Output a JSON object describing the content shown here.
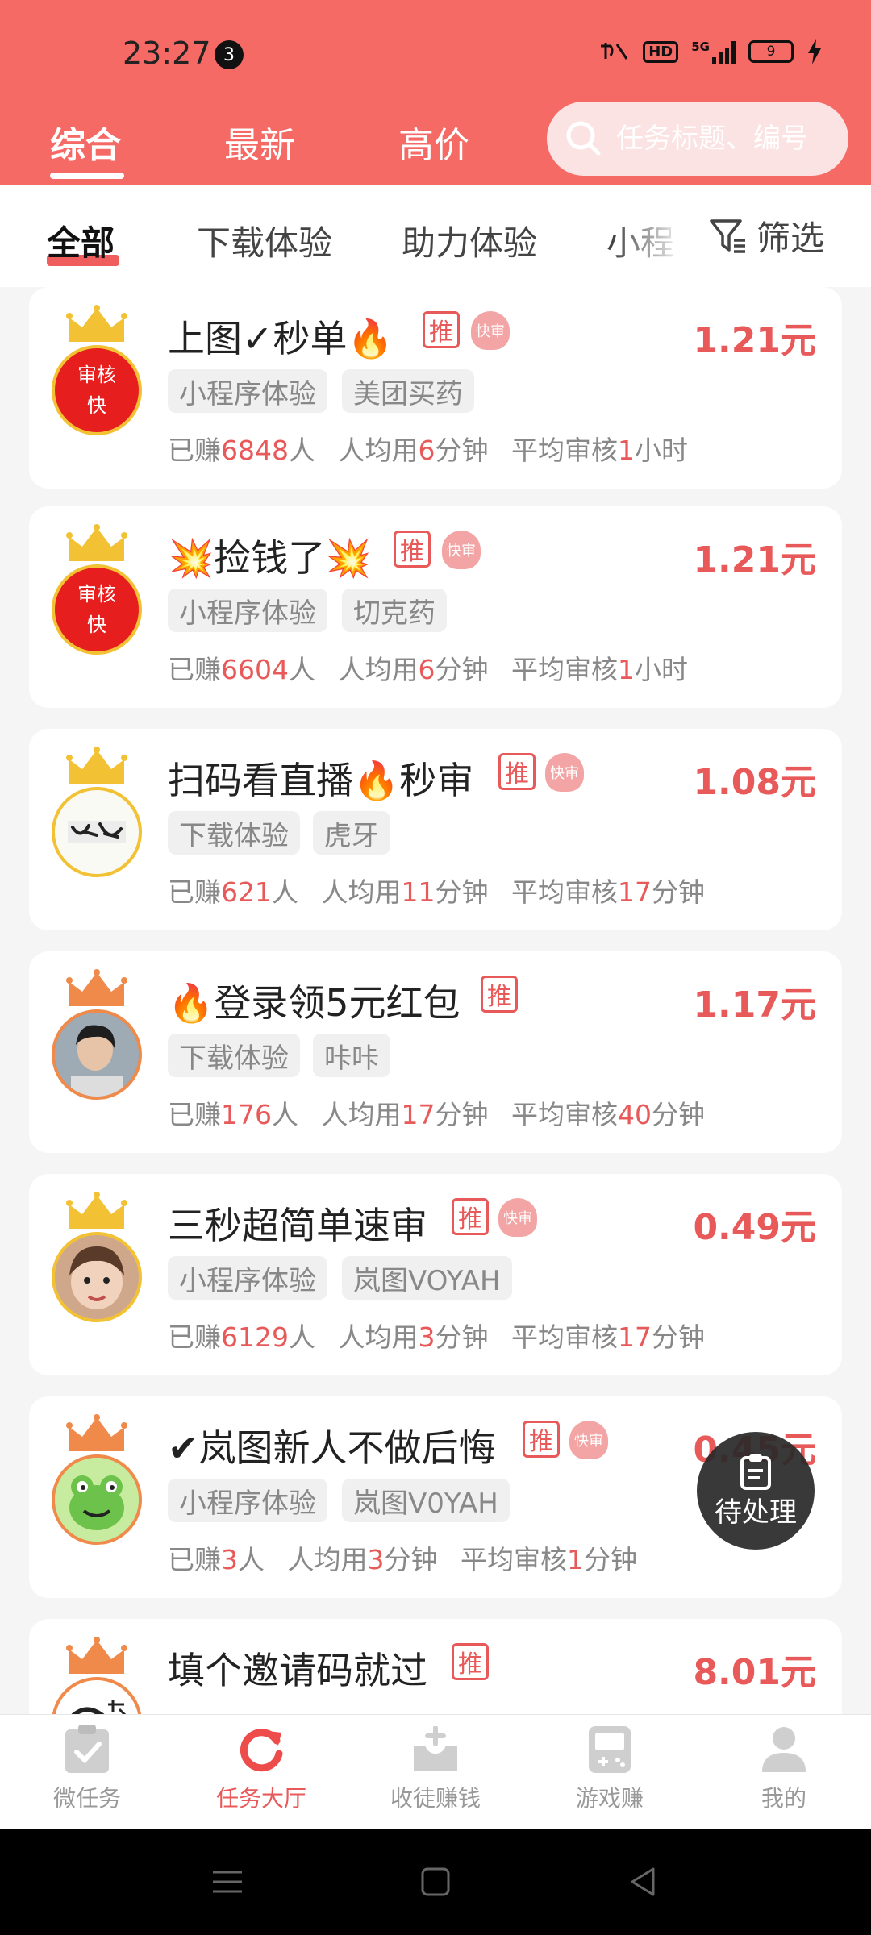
{
  "status": {
    "time": "23:27",
    "notif_count": "3",
    "hd": "HD",
    "network": "5G",
    "battery": "9"
  },
  "top_tabs": [
    {
      "label": "综合",
      "active": true
    },
    {
      "label": "最新",
      "active": false
    },
    {
      "label": "高价",
      "active": false
    }
  ],
  "search": {
    "placeholder": "任务标题、编号"
  },
  "categories": [
    {
      "label": "全部",
      "active": true
    },
    {
      "label": "下载体验"
    },
    {
      "label": "助力体验"
    },
    {
      "label": "小程"
    }
  ],
  "filter_label": "筛选",
  "tags": {
    "recommend": "推",
    "fast": "快审"
  },
  "avatar_text": {
    "review_fast_top": "审核",
    "review_fast_bottom": "快"
  },
  "tasks": [
    {
      "title": "上图✓秒单🔥",
      "price": "1.21元",
      "fast": true,
      "chips": [
        "小程序体验",
        "美团买药"
      ],
      "earned": "6848",
      "minutes": "6",
      "review_num": "1",
      "review_unit": "小时",
      "avatar": "review-fast",
      "crown": "gold"
    },
    {
      "title": "💥捡钱了💥",
      "price": "1.21元",
      "fast": true,
      "chips": [
        "小程序体验",
        "切克药"
      ],
      "earned": "6604",
      "minutes": "6",
      "review_num": "1",
      "review_unit": "小时",
      "avatar": "review-fast",
      "crown": "gold"
    },
    {
      "title": "扫码看直播🔥秒审",
      "price": "1.08元",
      "fast": true,
      "chips": [
        "下载体验",
        "虎牙"
      ],
      "earned": "621",
      "minutes": "11",
      "review_num": "17",
      "review_unit": "分钟",
      "avatar": "calligraphy",
      "crown": "gold"
    },
    {
      "title": "🔥登录领5元红包",
      "price": "1.17元",
      "fast": false,
      "chips": [
        "下载体验",
        "咔咔"
      ],
      "earned": "176",
      "minutes": "17",
      "review_num": "40",
      "review_unit": "分钟",
      "avatar": "person",
      "crown": "orange"
    },
    {
      "title": "三秒超简单速审",
      "price": "0.49元",
      "fast": true,
      "chips": [
        "小程序体验",
        "岚图VOYAH"
      ],
      "earned": "6129",
      "minutes": "3",
      "review_num": "17",
      "review_unit": "分钟",
      "avatar": "child",
      "crown": "gold"
    },
    {
      "title": "✔岚图新人不做后悔",
      "price": "0.45元",
      "fast": true,
      "chips": [
        "小程序体验",
        "岚图V0YAH"
      ],
      "earned": "3",
      "minutes": "3",
      "review_num": "1",
      "review_unit": "分钟",
      "avatar": "frog",
      "crown": "orange"
    },
    {
      "title": "填个邀请码就过",
      "price": "8.01元",
      "fast": false,
      "chips": [],
      "earned": "",
      "minutes": "",
      "review_num": "",
      "review_unit": "",
      "avatar": "sketch",
      "crown": "orange"
    }
  ],
  "stat_labels": {
    "earned_prefix": "已赚",
    "earned_suffix": "人",
    "avg_prefix": "人均用",
    "avg_suffix": "分钟",
    "review_prefix": "平均审核"
  },
  "pending_label": "待处理",
  "bottom_nav": [
    {
      "label": "微任务",
      "icon": "clipboard-check-icon"
    },
    {
      "label": "任务大厅",
      "icon": "refresh-icon",
      "active": true
    },
    {
      "label": "收徒赚钱",
      "icon": "inbox-plus-icon"
    },
    {
      "label": "游戏赚",
      "icon": "gamepad-icon"
    },
    {
      "label": "我的",
      "icon": "user-icon"
    }
  ],
  "colors": {
    "header": "#f66a66",
    "accent": "#e85a5a"
  }
}
